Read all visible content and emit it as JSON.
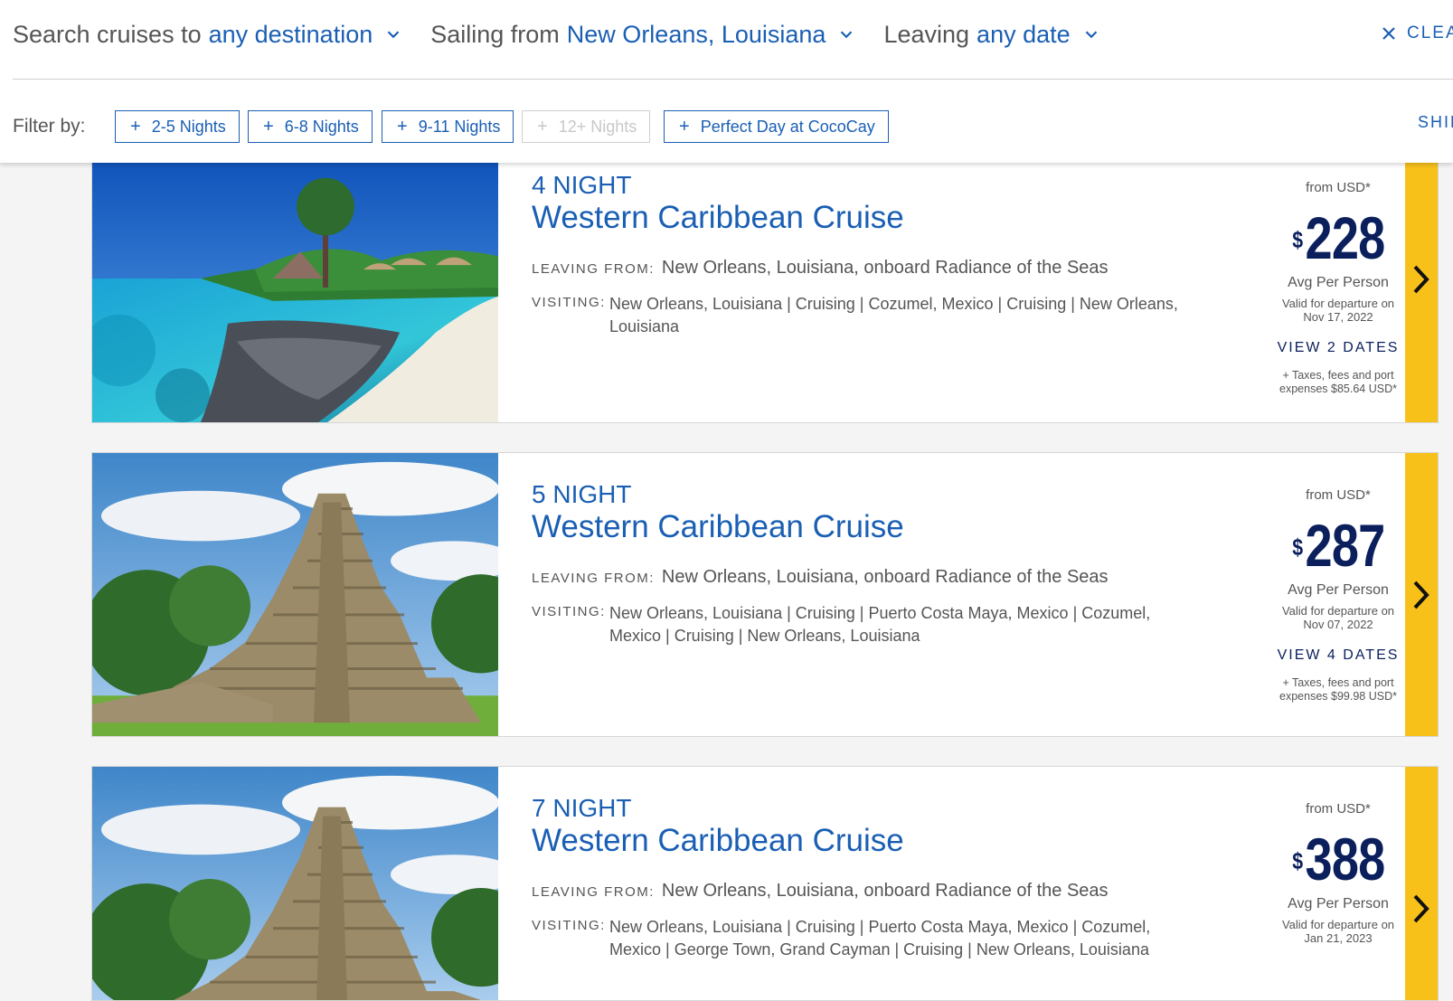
{
  "search": {
    "destination": {
      "prefix": "Search cruises to",
      "value": "any destination"
    },
    "port": {
      "prefix": "Sailing from",
      "value": "New Orleans, Louisiana"
    },
    "date": {
      "prefix": "Leaving",
      "value": "any date"
    },
    "clear_label": "CLEA"
  },
  "filters": {
    "label": "Filter by:",
    "chips": [
      {
        "label": "2-5 Nights",
        "enabled": true
      },
      {
        "label": "6-8 Nights",
        "enabled": true
      },
      {
        "label": "9-11 Nights",
        "enabled": true
      },
      {
        "label": "12+ Nights",
        "enabled": false
      },
      {
        "label": "Perfect Day at CocoCay",
        "enabled": true
      }
    ],
    "ships_label": "SHIP"
  },
  "labels": {
    "leaving_from": "LEAVING FROM:",
    "visiting": "VISITING:",
    "from_currency": "from USD*",
    "avg_per_person": "Avg Per Person",
    "currency_symbol": "$"
  },
  "cruises": [
    {
      "nights": "4 NIGHT",
      "title": "Western Caribbean Cruise",
      "leaving_from": "New Orleans, Louisiana, onboard Radiance of the Seas",
      "visiting": "New Orleans, Louisiana  |  Cruising  |  Cozumel, Mexico  |  Cruising  |  New Orleans, Louisiana",
      "price": "228",
      "valid_line1": "Valid for departure on",
      "valid_line2": "Nov 17, 2022",
      "view_dates": "VIEW 2 DATES",
      "taxes_line1": "+ Taxes, fees and port",
      "taxes_line2": "expenses $85.64 USD*",
      "image": "beach-cove"
    },
    {
      "nights": "5 NIGHT",
      "title": "Western Caribbean Cruise",
      "leaving_from": "New Orleans, Louisiana, onboard Radiance of the Seas",
      "visiting": "New Orleans, Louisiana  |  Cruising  |  Puerto Costa Maya, Mexico  |  Cozumel, Mexico  |  Cruising  |  New Orleans, Louisiana",
      "price": "287",
      "valid_line1": "Valid for departure on",
      "valid_line2": "Nov 07, 2022",
      "view_dates": "VIEW 4 DATES",
      "taxes_line1": "+ Taxes, fees and port",
      "taxes_line2": "expenses $99.98 USD*",
      "image": "mayan-pyramid"
    },
    {
      "nights": "7 NIGHT",
      "title": "Western Caribbean Cruise",
      "leaving_from": "New Orleans, Louisiana, onboard Radiance of the Seas",
      "visiting": "New Orleans, Louisiana  |  Cruising  |  Puerto Costa Maya, Mexico  |  Cozumel, Mexico  |  George Town, Grand Cayman  |  Cruising  |  New Orleans, Louisiana",
      "price": "388",
      "valid_line1": "Valid for departure on",
      "valid_line2": "Jan 21, 2023",
      "image": "mayan-pyramid"
    }
  ],
  "colors": {
    "brand_blue": "#1a5fb4",
    "price_navy": "#0b1f5c",
    "arrow_yellow": "#f8c11a"
  }
}
